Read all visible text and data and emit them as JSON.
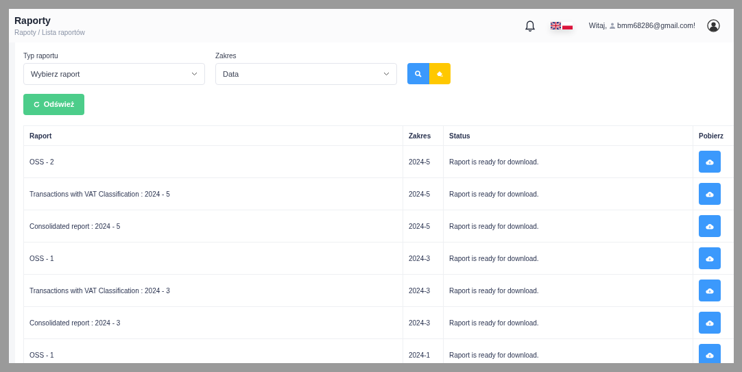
{
  "header": {
    "title": "Raporty",
    "breadcrumb": "Rapoty / Lista raportów",
    "greeting": "Witaj,",
    "user_email": "bmm68286@gmail.com!"
  },
  "filters": [
    {
      "label": "Typ raportu",
      "value": "Wybierz raport"
    },
    {
      "label": "Zakres",
      "value": "Data"
    }
  ],
  "refresh_button": "Odśwież",
  "table": {
    "columns": [
      "Raport",
      "Zakres",
      "Status",
      "Pobierz"
    ],
    "rows": [
      {
        "raport": "OSS - 2",
        "zakres": "2024-5",
        "status": "Raport is ready for download."
      },
      {
        "raport": "Transactions with VAT Classification : 2024 - 5",
        "zakres": "2024-5",
        "status": "Raport is ready for download."
      },
      {
        "raport": "Consolidated report : 2024 - 5",
        "zakres": "2024-5",
        "status": "Raport is ready for download."
      },
      {
        "raport": "OSS - 1",
        "zakres": "2024-3",
        "status": "Raport is ready for download."
      },
      {
        "raport": "Transactions with VAT Classification : 2024 - 3",
        "zakres": "2024-3",
        "status": "Raport is ready for download."
      },
      {
        "raport": "Consolidated report : 2024 - 3",
        "zakres": "2024-3",
        "status": "Raport is ready for download."
      },
      {
        "raport": "OSS - 1",
        "zakres": "2024-1",
        "status": "Raport is ready for download."
      }
    ]
  }
}
